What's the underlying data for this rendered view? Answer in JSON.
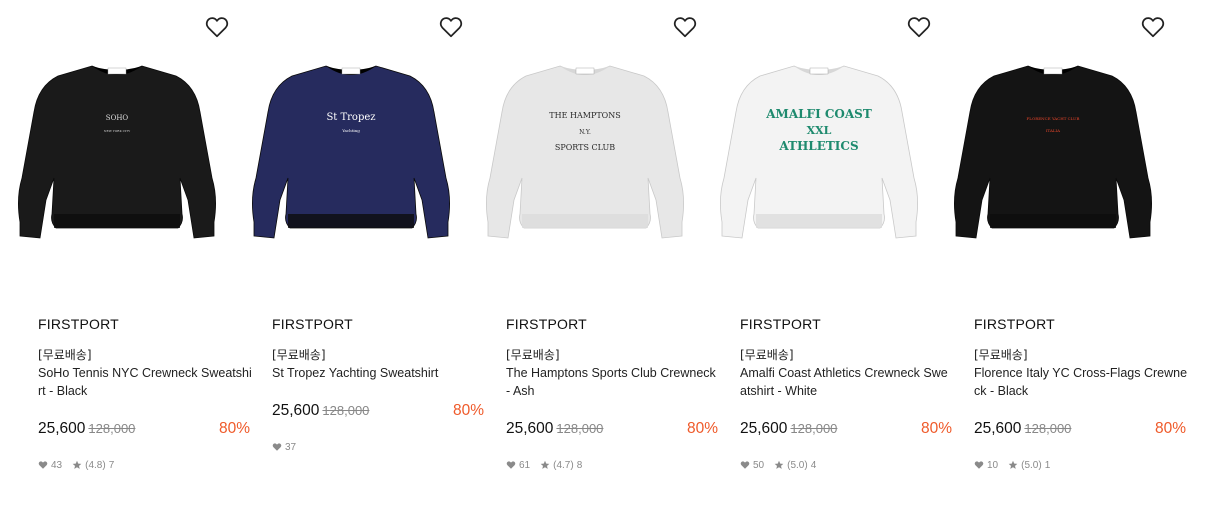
{
  "products": [
    {
      "brand": "FIRSTPORT",
      "tag": "[무료배송]",
      "name": "SoHo Tennis NYC Crewneck Sweatshirt - Black",
      "price": "25,600",
      "original_price": "128,000",
      "discount": "80%",
      "likes": "43",
      "rating": "(4.8)",
      "reviews": "7",
      "color": "#1a1a1a",
      "print_lines": [
        "SOHO",
        "NEW YORK CITY"
      ],
      "print_color": "#dddddd"
    },
    {
      "brand": "FIRSTPORT",
      "tag": "[무료배송]",
      "name": "St Tropez Yachting Sweatshirt",
      "price": "25,600",
      "original_price": "128,000",
      "discount": "80%",
      "likes": "37",
      "rating": "",
      "reviews": "",
      "color": "#262b5e",
      "print_lines": [
        "St Tropez",
        "Yachting"
      ],
      "print_color": "#ffffff"
    },
    {
      "brand": "FIRSTPORT",
      "tag": "[무료배송]",
      "name": "The Hamptons Sports Club Crewneck - Ash",
      "price": "25,600",
      "original_price": "128,000",
      "discount": "80%",
      "likes": "61",
      "rating": "(4.7)",
      "reviews": "8",
      "color": "#e7e7e7",
      "print_lines": [
        "THE HAMPTONS",
        "N.Y.",
        "SPORTS CLUB"
      ],
      "print_color": "#2a2a2a"
    },
    {
      "brand": "FIRSTPORT",
      "tag": "[무료배송]",
      "name": "Amalfi Coast Athletics Crewneck Sweatshirt - White",
      "price": "25,600",
      "original_price": "128,000",
      "discount": "80%",
      "likes": "50",
      "rating": "(5.0)",
      "reviews": "4",
      "color": "#f3f3f3",
      "print_lines": [
        "AMALFI COAST",
        "XXL",
        "ATHLETICS"
      ],
      "print_color": "#1e8a6e"
    },
    {
      "brand": "FIRSTPORT",
      "tag": "[무료배송]",
      "name": "Florence Italy YC Cross-Flags Crewneck - Black",
      "price": "25,600",
      "original_price": "128,000",
      "discount": "80%",
      "likes": "10",
      "rating": "(5.0)",
      "reviews": "1",
      "color": "#141414",
      "print_lines": [
        "FLORENCE YACHT CLUB",
        "ITALIA"
      ],
      "print_color": "#e8452a"
    }
  ],
  "icons": {
    "wish": "heart-outline-icon",
    "like": "heart-icon",
    "rating": "star-icon"
  },
  "colors": {
    "discount": "#ef5a2a",
    "meta": "#8a8a8a"
  }
}
